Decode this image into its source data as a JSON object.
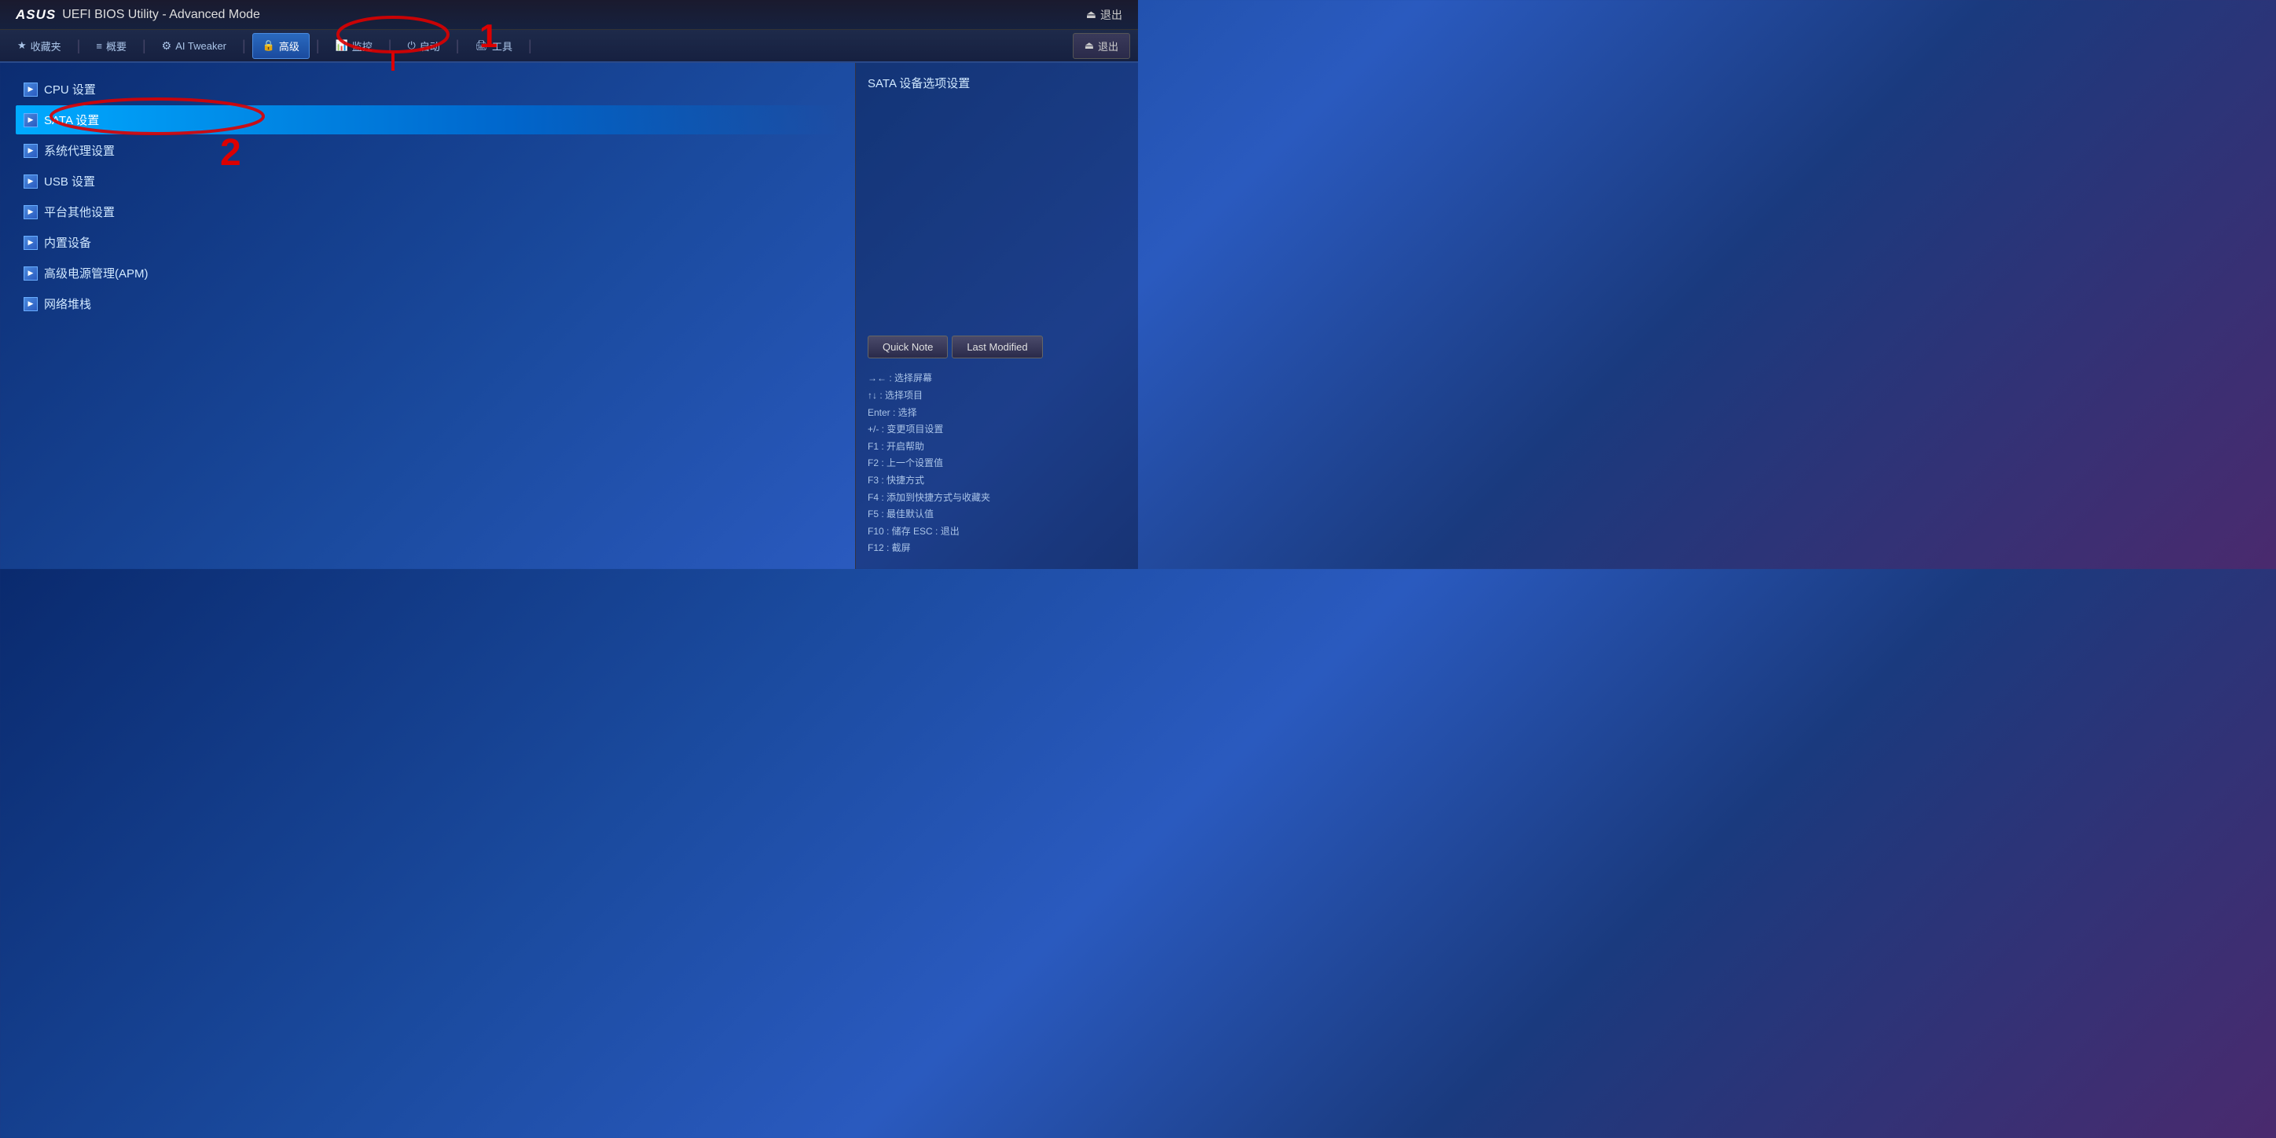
{
  "titleBar": {
    "logo": "ASUS",
    "title": "UEFI BIOS Utility - Advanced Mode",
    "exitLabel": "退出"
  },
  "nav": {
    "items": [
      {
        "id": "favorites",
        "icon": "★",
        "label": "收藏夹"
      },
      {
        "id": "overview",
        "icon": "≡",
        "label": "概要"
      },
      {
        "id": "ai-tweaker",
        "icon": "⚙",
        "label": "AI Tweaker"
      },
      {
        "id": "advanced",
        "icon": "🔒",
        "label": "高级",
        "active": true
      },
      {
        "id": "monitor",
        "icon": "📊",
        "label": "监控"
      },
      {
        "id": "boot",
        "icon": "⏻",
        "label": "启动"
      },
      {
        "id": "tools",
        "icon": "🖨",
        "label": "工具"
      }
    ],
    "exitLabel": "退出"
  },
  "leftMenu": {
    "items": [
      {
        "id": "cpu",
        "label": "CPU 设置"
      },
      {
        "id": "sata",
        "label": "SATA 设置",
        "selected": true
      },
      {
        "id": "system",
        "label": "系统代理设置"
      },
      {
        "id": "usb",
        "label": "USB 设置"
      },
      {
        "id": "platform",
        "label": "平台其他设置"
      },
      {
        "id": "builtin",
        "label": "内置设备"
      },
      {
        "id": "apm",
        "label": "高级电源管理(APM)"
      },
      {
        "id": "network",
        "label": "网络堆栈"
      }
    ]
  },
  "rightPanel": {
    "description": "SATA 设备选项设置",
    "quickNoteLabel": "Quick Note",
    "lastModifiedLabel": "Last Modified",
    "helpLines": [
      "→← : 选择屏幕",
      "↑↓ : 选择项目",
      "Enter : 选择",
      "+/- : 变更项目设置",
      "F1 : 开启帮助",
      "F2 : 上一个设置值",
      "F3 : 快捷方式",
      "F4 : 添加到快捷方式与收藏夹",
      "F5 : 最佳默认值",
      "F10 : 储存  ESC : 退出",
      "F12 : 截屏"
    ]
  }
}
